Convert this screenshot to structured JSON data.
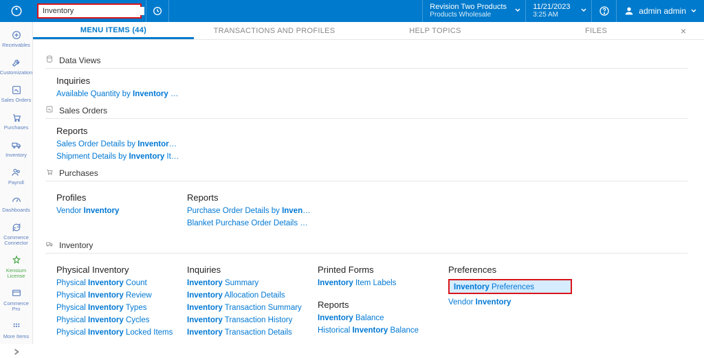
{
  "search": {
    "value": "Inventory"
  },
  "header": {
    "company_l1": "Revision Two Products",
    "company_l2": "Products Wholesale",
    "date_l1": "11/21/2023",
    "date_l2": "3:25 AM",
    "user": "admin admin"
  },
  "sidebar": [
    {
      "label": "Receivables"
    },
    {
      "label": "Customization"
    },
    {
      "label": "Sales Orders"
    },
    {
      "label": "Purchases"
    },
    {
      "label": "Inventory"
    },
    {
      "label": "Payroll"
    },
    {
      "label": "Dashboards"
    },
    {
      "label": "Commerce Connector"
    },
    {
      "label": "Kensium License"
    },
    {
      "label": "Commerce Pro"
    },
    {
      "label": "More Items"
    }
  ],
  "tabs": [
    {
      "label": "MENU ITEMS  (44)"
    },
    {
      "label": "TRANSACTIONS AND PROFILES"
    },
    {
      "label": "HELP TOPICS"
    },
    {
      "label": "FILES"
    }
  ],
  "sections": {
    "dataviews": {
      "title": "Data Views",
      "inquiries": {
        "head": "Inquiries",
        "items": [
          "Available Quantity by |Inventory| …"
        ]
      }
    },
    "salesorders": {
      "title": "Sales Orders",
      "reports": {
        "head": "Reports",
        "items": [
          "Sales Order Details by |Inventor|…",
          "Shipment Details by |Inventory| It…"
        ]
      }
    },
    "purchases": {
      "title": "Purchases",
      "profiles": {
        "head": "Profiles",
        "items": [
          "Vendor |Inventory|"
        ]
      },
      "reports": {
        "head": "Reports",
        "items": [
          "Purchase Order Details by |Inven|…",
          "Blanket Purchase Order Details …"
        ]
      }
    },
    "inventory": {
      "title": "Inventory",
      "physical": {
        "head": "Physical Inventory",
        "items": [
          "Physical |Inventory| Count",
          "Physical |Inventory| Review",
          "Physical |Inventory| Types",
          "Physical |Inventory| Cycles",
          "Physical |Inventory| Locked Items"
        ]
      },
      "inquiries": {
        "head": "Inquiries",
        "items": [
          "|Inventory| Summary",
          "|Inventory| Allocation Details",
          "|Inventory| Transaction Summary",
          "|Inventory| Transaction History",
          "|Inventory| Transaction Details"
        ]
      },
      "printed": {
        "head": "Printed Forms",
        "items": [
          "|Inventory| Item Labels"
        ]
      },
      "reports2": {
        "head": "Reports",
        "items": [
          "|Inventory| Balance",
          "Historical |Inventory| Balance"
        ]
      },
      "prefs": {
        "head": "Preferences",
        "items": [
          "|Inventory| Preferences",
          "Vendor |Inventory|"
        ],
        "hl": 0
      }
    }
  }
}
